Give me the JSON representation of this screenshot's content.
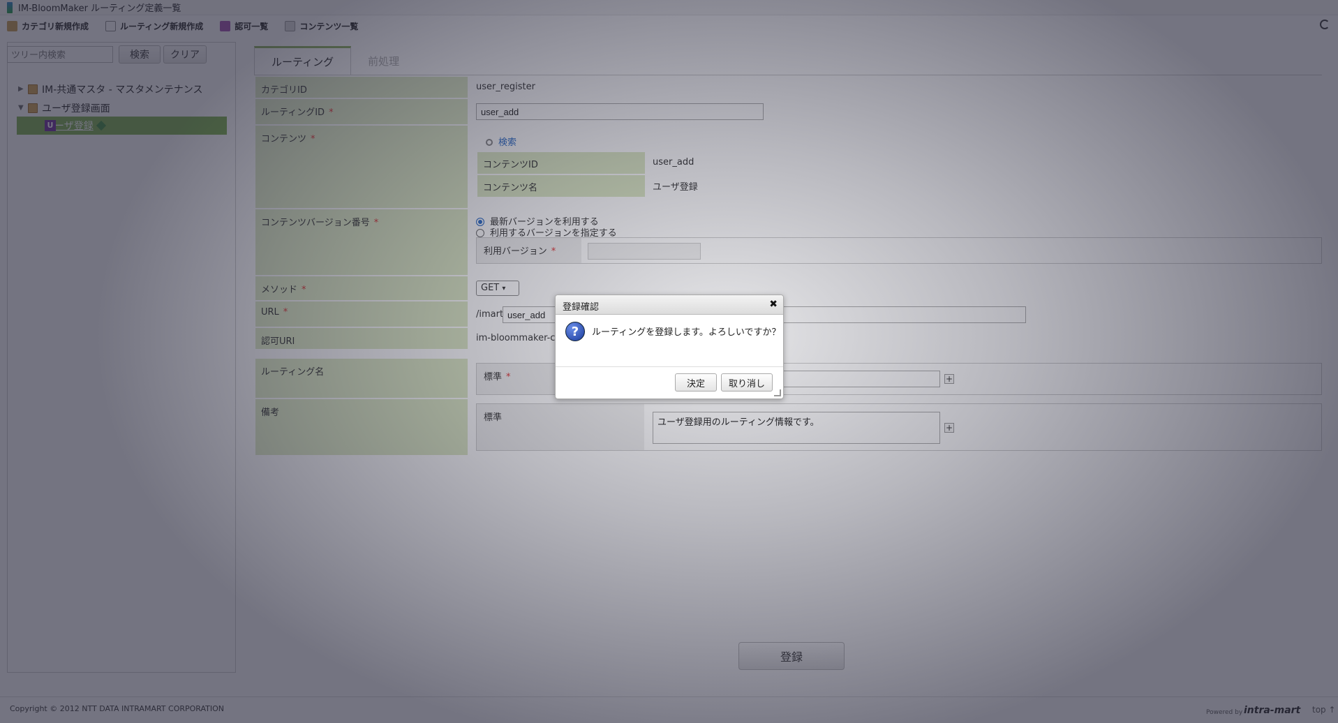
{
  "window": {
    "title": "IM-BloomMaker ルーティング定義一覧"
  },
  "toolbar": {
    "items": [
      {
        "label": "カテゴリ新規作成",
        "icon": "category-icon"
      },
      {
        "label": "ルーティング新規作成",
        "icon": "routing-icon"
      },
      {
        "label": "認可一覧",
        "icon": "authorization-icon"
      },
      {
        "label": "コンテンツ一覧",
        "icon": "contents-icon"
      }
    ]
  },
  "sidebar": {
    "search_placeholder": "ツリー内検索",
    "search_button": "検索",
    "clear_button": "クリア",
    "tree": [
      {
        "label": "IM-共通マスタ - マスタメンテナンス",
        "expanded": false
      },
      {
        "label": "ユーザ登録画面",
        "expanded": true
      },
      {
        "label": "ユーザ登録",
        "selected": true,
        "badge": "U"
      }
    ]
  },
  "tabs": [
    {
      "label": "ルーティング",
      "active": true
    },
    {
      "label": "前処理",
      "active": false
    }
  ],
  "form": {
    "category_id_label": "カテゴリID",
    "category_id_value": "user_register",
    "routing_id_label": "ルーティングID",
    "routing_id_value": "user_add",
    "contents_label": "コンテンツ",
    "contents_search": "検索",
    "contents_id_label": "コンテンツID",
    "contents_id_value": "user_add",
    "contents_name_label": "コンテンツ名",
    "contents_name_value": "ユーザ登録",
    "version_label": "コンテンツバージョン番号",
    "version_opt_latest": "最新バージョンを利用する",
    "version_opt_specify": "利用するバージョンを指定する",
    "version_use_label": "利用バージョン",
    "method_label": "メソッド",
    "method_value": "GET",
    "url_label": "URL",
    "url_prefix": "/imart/",
    "url_value": "user_add",
    "auth_uri_label": "認可URI",
    "auth_uri_value": "im-bloommaker-conte",
    "routing_name_label": "ルーティング名",
    "standard_label": "標準",
    "remarks_label": "備考",
    "remarks_value": "ユーザ登録用のルーティング情報です。",
    "register_button": "登録"
  },
  "dialog": {
    "title": "登録確認",
    "message": "ルーティングを登録します。よろしいですか？",
    "ok_button": "決定",
    "cancel_button": "取り消し"
  },
  "footer": {
    "copyright": "Copyright © 2012 NTT DATA INTRAMART CORPORATION",
    "powered_by": "Powered by",
    "brand": "intra-mart",
    "top_link": "top ↑"
  }
}
